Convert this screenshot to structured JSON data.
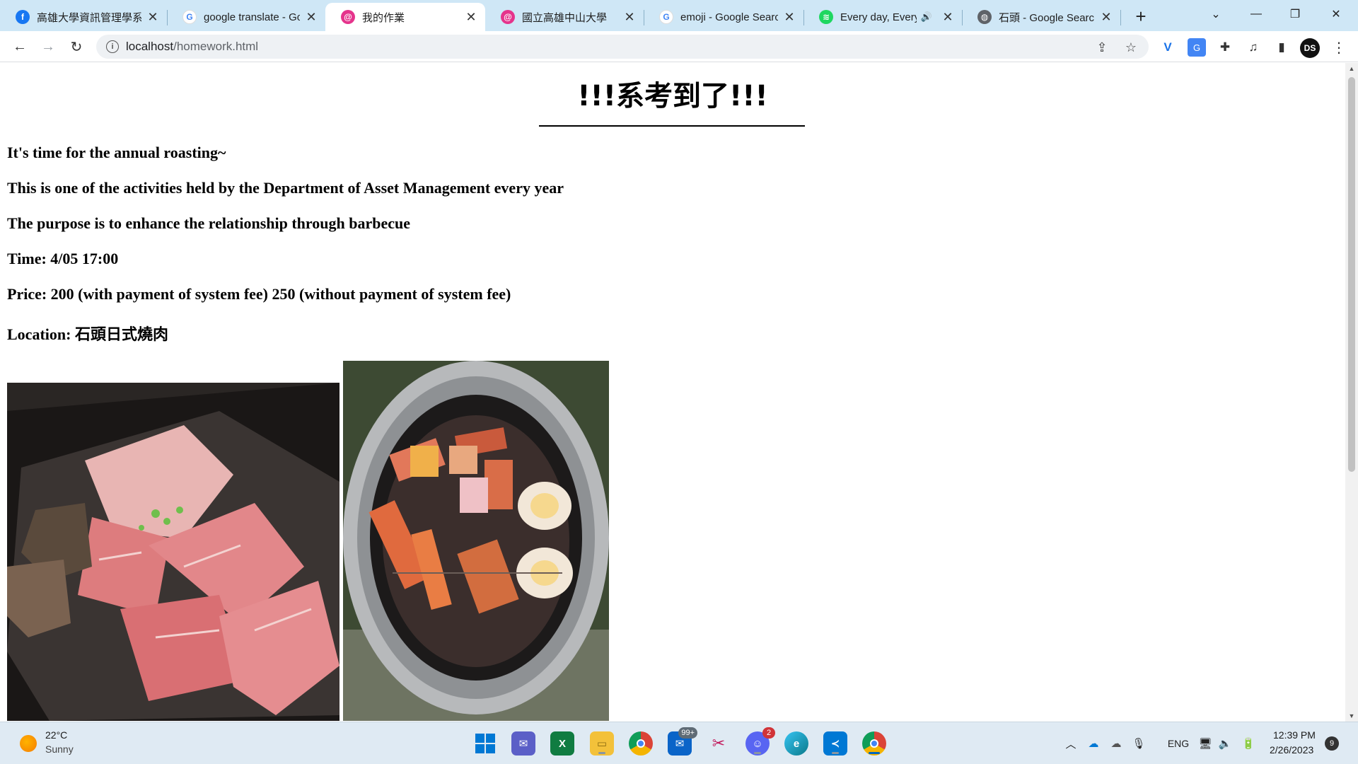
{
  "browser": {
    "tabs": [
      {
        "title": "高雄大學資訊管理學系",
        "icon": "facebook-icon",
        "color": "#1877f2",
        "glyph": "f"
      },
      {
        "title": "google translate - Goo",
        "icon": "google-icon",
        "color": "#4285f4",
        "glyph": "G"
      },
      {
        "title": "我的作業",
        "icon": "localhost-app-icon",
        "color": "#e5348c",
        "glyph": "@"
      },
      {
        "title": "國立高雄中山大學",
        "icon": "nsysu-app-icon",
        "color": "#e5348c",
        "glyph": "@"
      },
      {
        "title": "emoji - Google Search",
        "icon": "google-icon",
        "color": "#4285f4",
        "glyph": "G"
      },
      {
        "title": "Every day, Every M",
        "icon": "spotify-icon",
        "color": "#1ed760",
        "glyph": "≋"
      },
      {
        "title": "石頭 - Google Search",
        "icon": "globe-icon",
        "color": "#5f6368",
        "glyph": "◍"
      }
    ],
    "new_tab_glyph": "+",
    "url_host": "localhost",
    "url_path": "/homework.html",
    "profile_initials": "DS"
  },
  "page": {
    "title": "!!!系考到了!!!",
    "paragraphs": [
      "It's time for the annual roasting~",
      "This is one of the activities held by the Department of Asset Management every year",
      "The purpose is to enhance the relationship through barbecue",
      "Time: 4/05 17:00",
      "Price: 200 (with payment of system fee) 250 (without payment of system fee)"
    ],
    "location_label": "Location: ",
    "location_value": "石頭日式燒肉"
  },
  "taskbar": {
    "temperature": "22°C",
    "condition": "Sunny",
    "mail_badge": "99+",
    "discord_badge": "2",
    "language": "ENG",
    "time": "12:39 PM",
    "date": "2/26/2023",
    "notification_count": "9"
  }
}
